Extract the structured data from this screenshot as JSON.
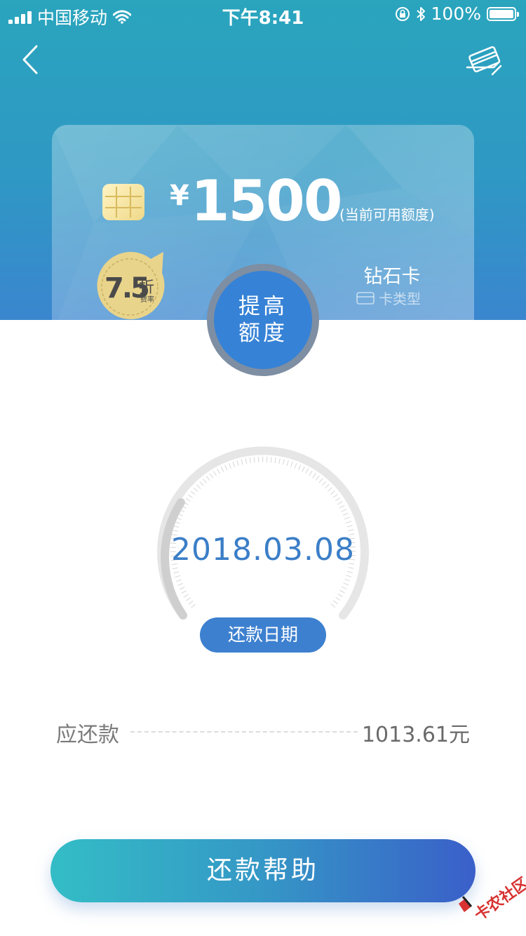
{
  "status_bar": {
    "carrier": "中国移动",
    "time": "下午8:41",
    "battery": "100%"
  },
  "card": {
    "currency": "¥",
    "amount": "1500",
    "amount_label": "(当前可用额度)",
    "card_type_name": "钻石卡",
    "card_type_label": "卡类型",
    "discount_value": "7.5",
    "discount_unit": "折",
    "discount_sub": "费率"
  },
  "raise_limit_button": "提高额度",
  "repayment": {
    "due_date": "2018.03.08",
    "due_date_label": "还款日期",
    "amount_due_label": "应还款",
    "amount_due_value": "1013.61元"
  },
  "help_button": "还款帮助",
  "watermark": "卡农社区",
  "colors": {
    "header_gradient_top": "#2aa5bd",
    "header_gradient_bottom": "#3a86cf",
    "primary_blue": "#3682d6",
    "date_text": "#3b7ec7",
    "help_gradient_start": "#33bdc6",
    "help_gradient_end": "#3a5fc9"
  },
  "icons": {
    "back": "chevron-left-icon",
    "card_switch": "credit-card-icon",
    "wifi": "wifi-icon",
    "lock": "rotation-lock-icon",
    "bluetooth": "bluetooth-icon",
    "chip": "card-chip-icon"
  }
}
